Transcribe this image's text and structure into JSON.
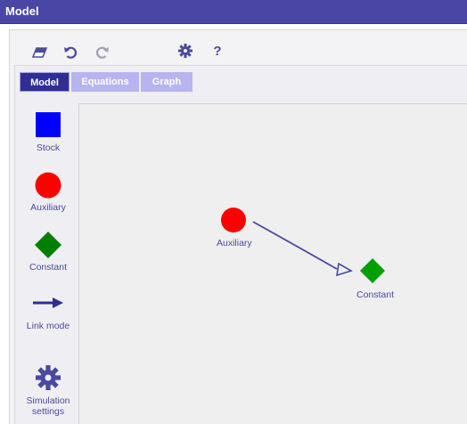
{
  "window": {
    "title": "Model"
  },
  "toolbar": {
    "eraser_icon": "eraser-icon",
    "undo_icon": "undo-icon",
    "redo_icon": "redo-icon",
    "settings_icon": "gear-icon",
    "help_label": "?"
  },
  "tabs": [
    {
      "label": "Model",
      "active": true
    },
    {
      "label": "Equations",
      "active": false
    },
    {
      "label": "Graph",
      "active": false
    }
  ],
  "palette": [
    {
      "label": "Stock",
      "icon": "blue-square-icon"
    },
    {
      "label": "Auxiliary",
      "icon": "red-circle-icon"
    },
    {
      "label": "Constant",
      "icon": "green-diamond-icon"
    },
    {
      "label": "Link mode",
      "icon": "arrow-right-icon"
    },
    {
      "label": "Simulation settings",
      "icon": "gear-icon"
    }
  ],
  "canvas": {
    "nodes": [
      {
        "type": "auxiliary",
        "label": "Auxiliary"
      },
      {
        "type": "constant",
        "label": "Constant"
      }
    ],
    "links": [
      {
        "from": "Auxiliary",
        "to": "Constant"
      }
    ]
  },
  "colors": {
    "title_bar": "#4a46a6",
    "tab_active": "#2f2e96",
    "tab_inactive": "#b7b5ef",
    "stock": "#0000ff",
    "auxiliary": "#ff0000",
    "constant": "#008000",
    "link": "#4a4aa0",
    "label": "#4a4aa0"
  }
}
